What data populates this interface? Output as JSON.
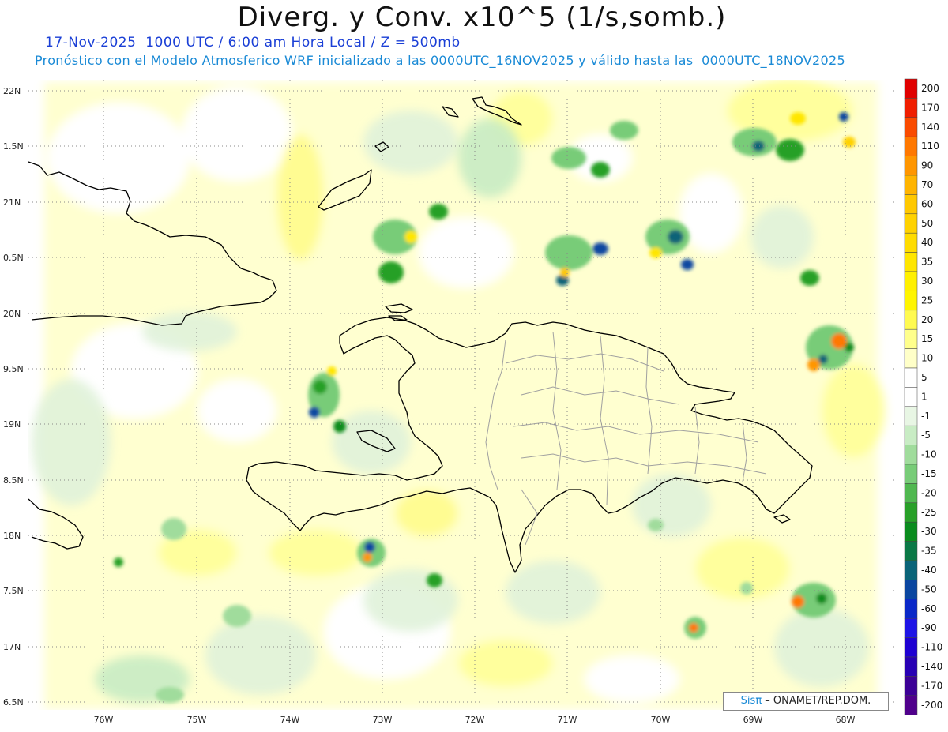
{
  "header": {
    "title": "Diverg. y Conv. x10^5 (1/s,somb.)",
    "datetime_line": "17-Nov-2025  1000 UTC / 6:00 am Hora Local / Z = 500mb",
    "model_line": "Pronóstico con el Modelo Atmosferico WRF inicializado a las 0000UTC_16NOV2025 y válido hasta las  0000UTC_18NOV2025"
  },
  "axes": {
    "lat_labels": [
      "22N",
      "1.5N",
      "21N",
      "0.5N",
      "20N",
      "9.5N",
      "19N",
      "8.5N",
      "18N",
      "7.5N",
      "17N",
      "6.5N"
    ],
    "lon_labels": [
      "76W",
      "75W",
      "74W",
      "73W",
      "72W",
      "71W",
      "70W",
      "69W",
      "68W"
    ]
  },
  "colorbar": {
    "labels": [
      "200",
      "170",
      "140",
      "110",
      "90",
      "70",
      "60",
      "50",
      "40",
      "35",
      "30",
      "25",
      "20",
      "15",
      "10",
      "5",
      "1",
      "-1",
      "-5",
      "-10",
      "-15",
      "-20",
      "-25",
      "-30",
      "-35",
      "-40",
      "-50",
      "-60",
      "-90",
      "-110",
      "-140",
      "-170",
      "-200"
    ],
    "colors": [
      "#e00000",
      "#f01e00",
      "#fa4b00",
      "#ff7800",
      "#ff9600",
      "#ffb400",
      "#ffc800",
      "#ffd200",
      "#ffdc00",
      "#ffe600",
      "#fff000",
      "#fff500",
      "#fffa50",
      "#ffff8c",
      "#ffffc8",
      "#ffffff",
      "#ffffff",
      "#e8f6e4",
      "#c8ecc4",
      "#a0dc9c",
      "#78cc78",
      "#50b850",
      "#28a028",
      "#0a8c1e",
      "#0a7846",
      "#0a6478",
      "#0a46a0",
      "#0a28c8",
      "#1e14e6",
      "#1e00d2",
      "#2800b4",
      "#3c0096",
      "#50008c"
    ]
  },
  "credit": {
    "logo_text": "Sis",
    "logo_pi": "π",
    "text": "– ONAMET/REP.DOM."
  },
  "colors": {
    "land_outline": "#000000",
    "province_lines": "#a0a0a0",
    "grid": "#888888"
  }
}
